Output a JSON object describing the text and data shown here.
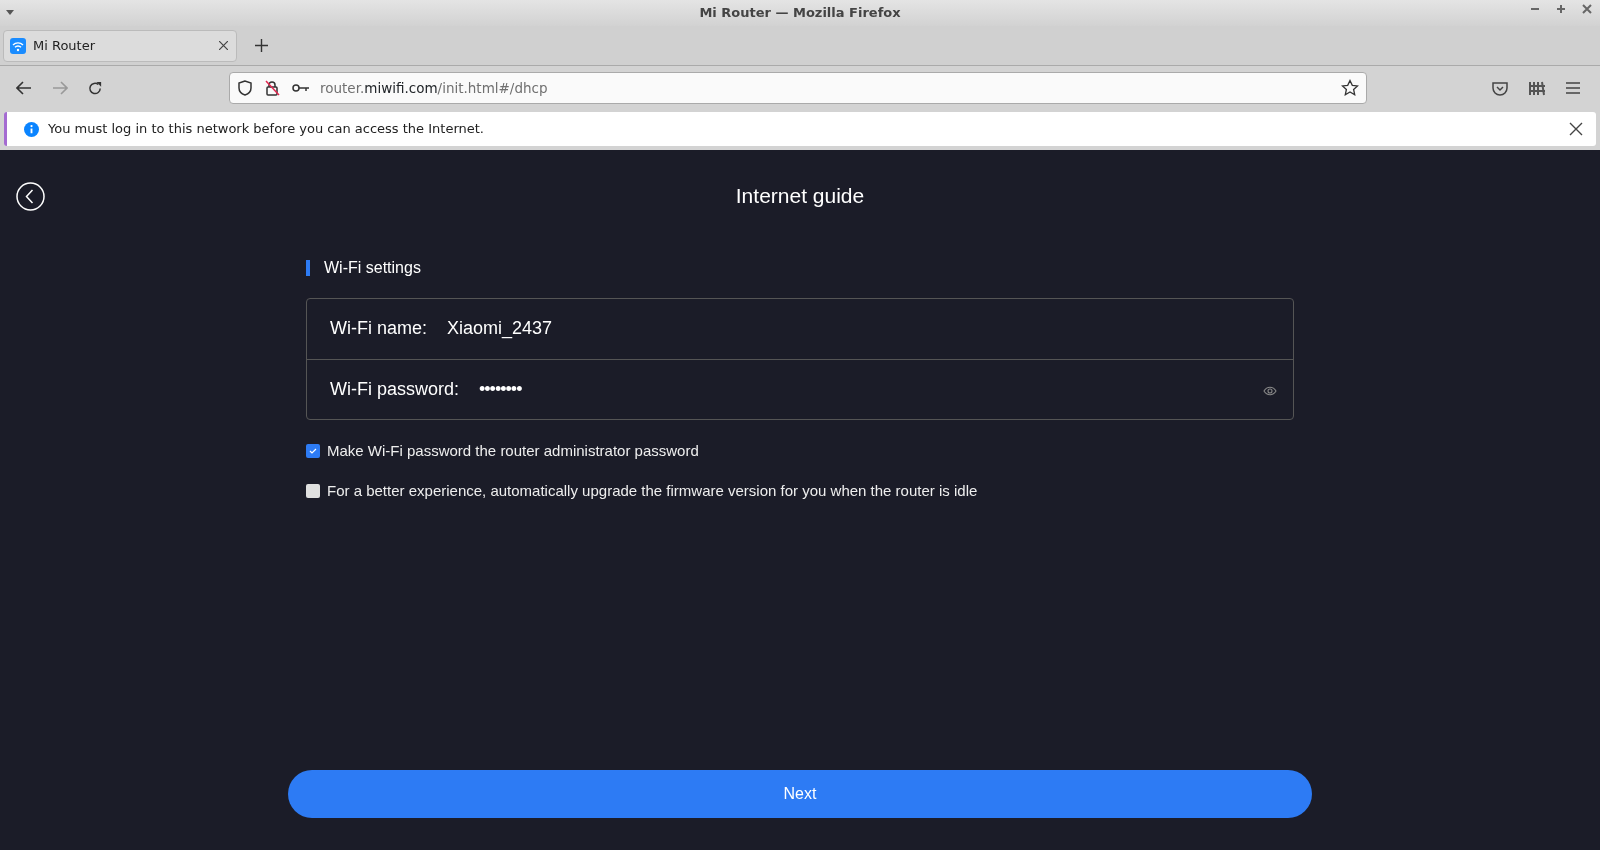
{
  "window": {
    "title": "Mi Router — Mozilla Firefox"
  },
  "tabs": [
    {
      "label": "Mi Router",
      "selected": true
    }
  ],
  "address_bar": {
    "url_before": "router.",
    "url_domain": "miwifi.com",
    "url_after": "/init.html#/dhcp"
  },
  "notification": {
    "text": "You must log in to this network before you can access the Internet."
  },
  "page": {
    "title": "Internet guide",
    "section": "Wi-Fi settings",
    "fields": [
      {
        "kind": "text",
        "label": "Wi-Fi name:",
        "value": "Xiaomi_2437"
      },
      {
        "kind": "password",
        "label": "Wi-Fi password:",
        "value": "••••••••"
      }
    ],
    "options": [
      {
        "label": "Make Wi-Fi password the router administrator password",
        "checked": true
      },
      {
        "label": "For a better experience, automatically upgrade the firmware version for you when the router is idle",
        "checked": false
      }
    ],
    "next_button": "Next"
  }
}
